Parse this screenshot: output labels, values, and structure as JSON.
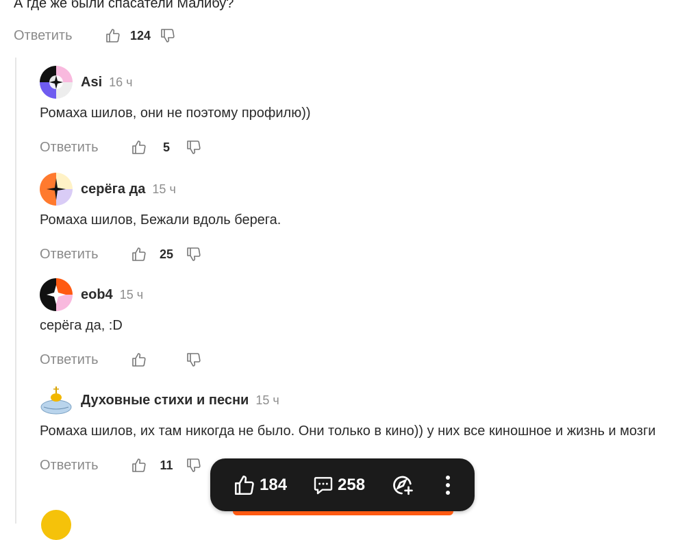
{
  "parent_comment": {
    "text": "А где же были спасатели Малибу?",
    "reply_label": "Ответить",
    "likes": "124"
  },
  "comments": [
    {
      "author": "Asi",
      "time": "16 ч",
      "text": "Ромаха шилов, они не поэтому профилю))",
      "reply_label": "Ответить",
      "likes": "5"
    },
    {
      "author": "серёга да",
      "time": "15 ч",
      "text": "Ромаха шилов, Бежали вдоль берега.",
      "reply_label": "Ответить",
      "likes": "25"
    },
    {
      "author": "eob4",
      "time": "15 ч",
      "text": "серёга да, :D",
      "reply_label": "Ответить",
      "likes": ""
    },
    {
      "author": "Духовные стихи и песни",
      "time": "15 ч",
      "text": "Ромаха шилов, их там никогда не было. Они только в кино)) у них все киношное и жизнь и мозги",
      "reply_label": "Ответить",
      "likes": "11"
    }
  ],
  "bottom_bar": {
    "likes": "184",
    "comments": "258"
  },
  "colors": {
    "accent": "#ff5a12",
    "bar_bg": "#1b1b1b",
    "muted_text": "#8a8a8a"
  }
}
